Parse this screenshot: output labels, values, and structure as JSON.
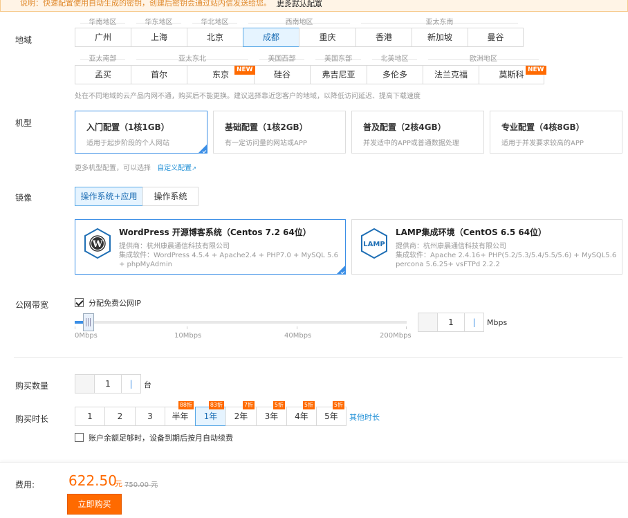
{
  "notice": {
    "text": "说明：快速配置使用自动生成的密钥，创建后密钥会通过站内信发送给您。",
    "more": "更多默认配置"
  },
  "region": {
    "label": "地域",
    "row1_groups": [
      "华南地区",
      "华东地区",
      "华北地区",
      "西南地区",
      "亚太东南"
    ],
    "row1": [
      "广州",
      "上海",
      "北京",
      "成都",
      "重庆",
      "香港",
      "新加坡",
      "曼谷"
    ],
    "row2_groups": [
      "亚太南部",
      "亚太东北",
      "美国西部",
      "美国东部",
      "北美地区",
      "欧洲地区"
    ],
    "row2": [
      "孟买",
      "首尔",
      "东京",
      "硅谷",
      "弗吉尼亚",
      "多伦多",
      "法兰克福",
      "莫斯科"
    ],
    "new_badge": "NEW",
    "hint": "处在不同地域的云产品内网不通，购买后不能更换。建议选择靠近您客户的地域，以降低访问延迟、提高下载速度"
  },
  "machine": {
    "label": "机型",
    "cards": [
      {
        "title": "入门配置（1核1GB）",
        "desc": "适用于起步阶段的个人网站"
      },
      {
        "title": "基础配置（1核2GB）",
        "desc": "有一定访问量的网站或APP"
      },
      {
        "title": "普及配置（2核4GB）",
        "desc": "并发适中的APP或普通数据处理"
      },
      {
        "title": "专业配置（4核8GB）",
        "desc": "适用于并发要求较高的APP"
      }
    ],
    "more_text": "更多机型配置，可以选择",
    "custom_link": "自定义配置"
  },
  "image": {
    "label": "镜像",
    "tabs": [
      "操作系统+应用",
      "操作系统"
    ],
    "cards": [
      {
        "title": "WordPress 开源博客系统（Centos 7.2 64位）",
        "provider": "提供商：杭州康晨通信科技有限公司",
        "software": "集成软件：WordPress 4.5.4 + Apache2.4 + PHP7.0 + MySQL 5.6 + phpMyAdmin"
      },
      {
        "title": "LAMP集成环境（CentOS 6.5 64位）",
        "provider": "提供商：杭州康晨通信科技有限公司",
        "software": "集成软件：Apache 2.4.16+ PHP(5.2/5.3/5.4/5.5/5.6) + MySQL5.6 percona 5.6.25+ vsFTPd 2.2.2"
      }
    ],
    "lamp_logo_text": "LAMP"
  },
  "bandwidth": {
    "label": "公网带宽",
    "checkbox_label": "分配免费公网IP",
    "ticks": [
      "0Mbps",
      "10Mbps",
      "40Mbps",
      "200Mbps"
    ],
    "value": "1",
    "unit": "Mbps"
  },
  "quantity": {
    "label": "购买数量",
    "value": "1",
    "unit": "台"
  },
  "duration": {
    "label": "购买时长",
    "options": [
      {
        "label": "1",
        "discount": ""
      },
      {
        "label": "2",
        "discount": ""
      },
      {
        "label": "3",
        "discount": ""
      },
      {
        "label": "半年",
        "discount": "88折"
      },
      {
        "label": "1年",
        "discount": "83折"
      },
      {
        "label": "2年",
        "discount": "7折"
      },
      {
        "label": "3年",
        "discount": "5折"
      },
      {
        "label": "4年",
        "discount": "5折"
      },
      {
        "label": "5年",
        "discount": "5折"
      }
    ],
    "other_link": "其他时长",
    "auto_renew": "账户余额足够时，设备到期后按月自动续费"
  },
  "footer": {
    "label": "费用:",
    "price": "622.50",
    "unit": "元",
    "original": "750.00 元",
    "buy_button": "立即购买"
  },
  "colors": {
    "accent": "#3a8ee6",
    "orange": "#ff6a00"
  }
}
